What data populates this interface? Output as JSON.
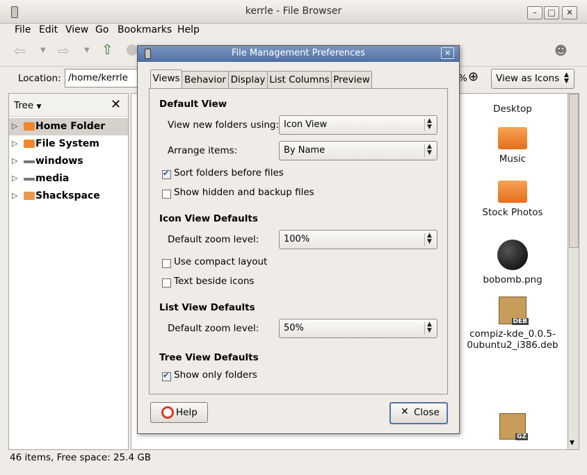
{
  "window": {
    "title": "kerrle - File Browser"
  },
  "menu": [
    "File",
    "Edit",
    "View",
    "Go",
    "Bookmarks",
    "Help"
  ],
  "location": {
    "label": "Location:",
    "value": "/home/kerrle",
    "zoom_fragment": "%",
    "view_mode": "View as Icons"
  },
  "sidepane": {
    "selector": "Tree",
    "items": [
      {
        "label": "Home Folder"
      },
      {
        "label": "File System"
      },
      {
        "label": "windows"
      },
      {
        "label": "media"
      },
      {
        "label": "Shackspace"
      }
    ]
  },
  "files": [
    {
      "name": "Desktop"
    },
    {
      "name": "Music"
    },
    {
      "name": "Stock Photos"
    },
    {
      "name": "bobomb.png"
    },
    {
      "name": "compiz-kde_0.0.5-\n0ubuntu2_i386.deb",
      "badge": "DEB"
    },
    {
      "badge": "GZ"
    }
  ],
  "status": "46 items, Free space: 25.4 GB",
  "dialog": {
    "title": "File Management Preferences",
    "tabs": [
      "Views",
      "Behavior",
      "Display",
      "List Columns",
      "Preview"
    ],
    "active_tab": "Views",
    "default_view": {
      "heading": "Default View",
      "new_folders_label": "View new folders using:",
      "new_folders_value": "Icon View",
      "arrange_label": "Arrange items:",
      "arrange_value": "By Name",
      "sort_folders": {
        "label": "Sort folders before files",
        "checked": true
      },
      "show_hidden": {
        "label": "Show hidden and backup files",
        "checked": false
      }
    },
    "icon_view": {
      "heading": "Icon View Defaults",
      "zoom_label": "Default zoom level:",
      "zoom_value": "100%",
      "compact": {
        "label": "Use compact layout",
        "checked": false
      },
      "text_beside": {
        "label": "Text beside icons",
        "checked": false
      }
    },
    "list_view": {
      "heading": "List View Defaults",
      "zoom_label": "Default zoom level:",
      "zoom_value": "50%"
    },
    "tree_view": {
      "heading": "Tree View Defaults",
      "only_folders": {
        "label": "Show only folders",
        "checked": true
      }
    },
    "help_button": "Help",
    "close_button": "Close"
  },
  "colors": {
    "title_active": "#5a7ab0",
    "selection": "#d6d1cb",
    "folder": "#f0872f"
  }
}
